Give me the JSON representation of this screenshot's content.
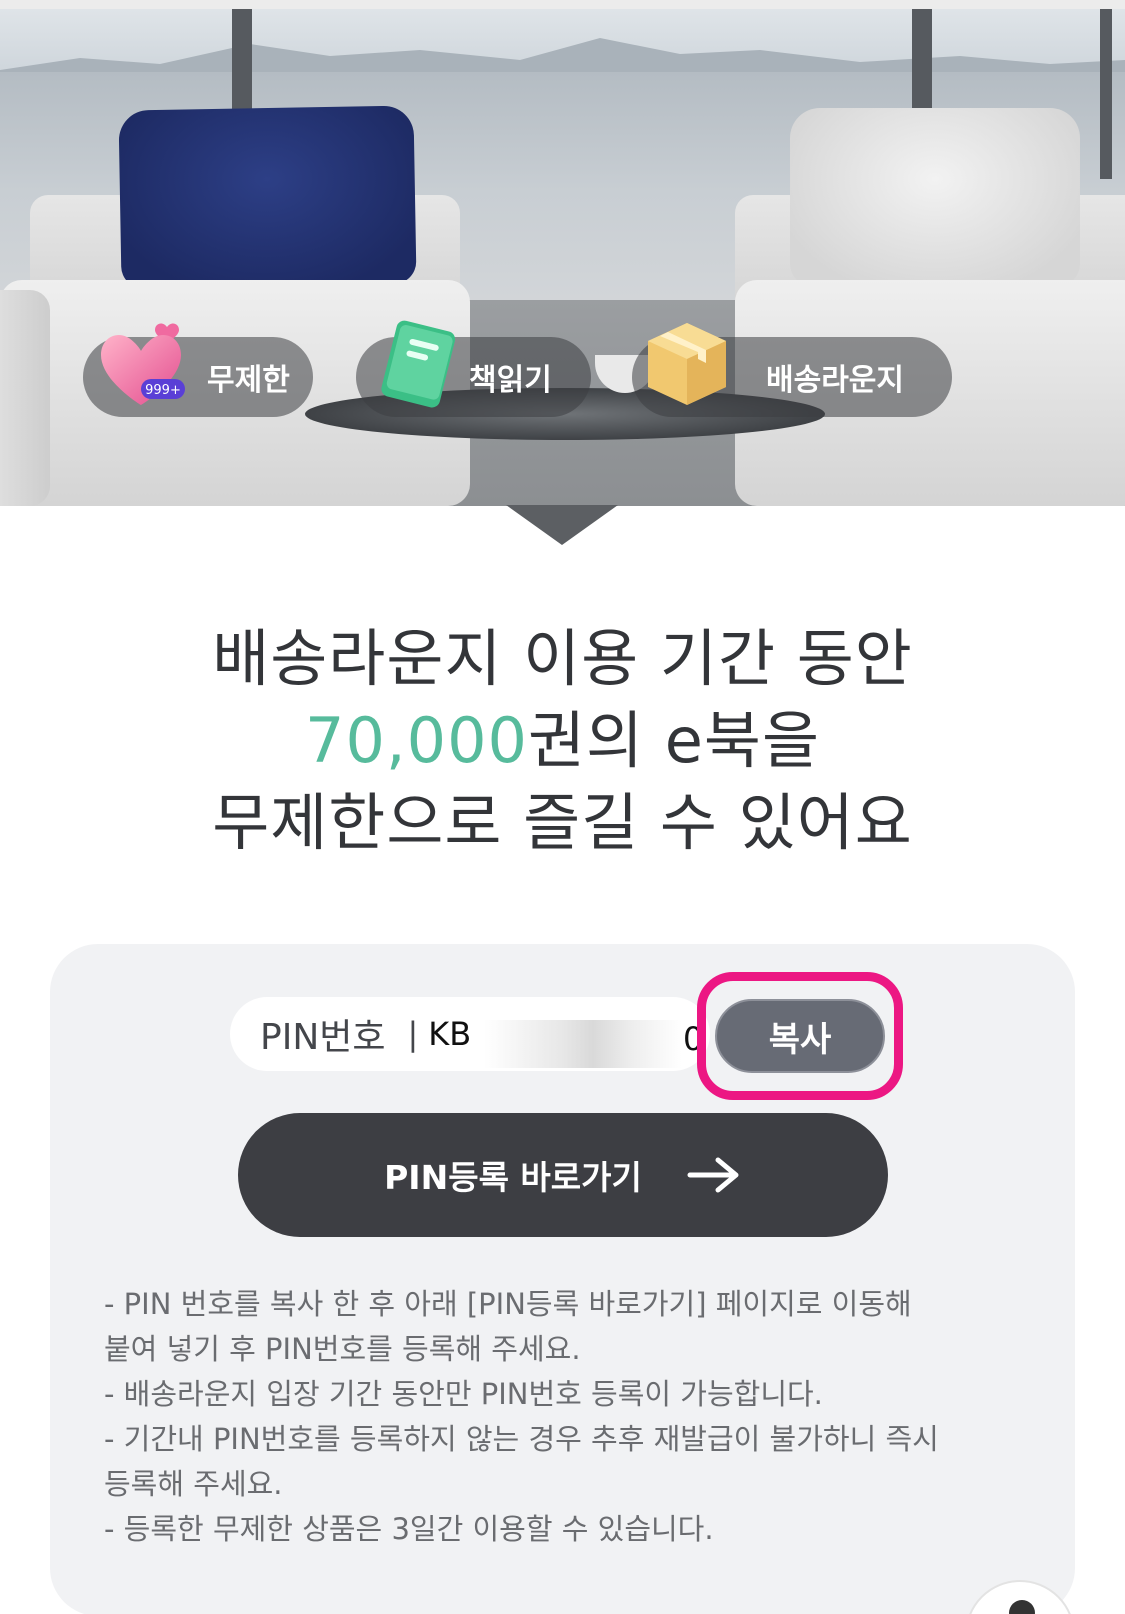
{
  "hero": {
    "chips": [
      {
        "label": "무제한",
        "icon": "heart-icon",
        "badge": "999+"
      },
      {
        "label": "책읽기",
        "icon": "book-icon"
      },
      {
        "label": "배송라운지",
        "icon": "box-icon"
      }
    ]
  },
  "headline": {
    "line1": "배송라운지 이용 기간 동안",
    "line2_accent": "70,000",
    "line2_rest": "권의 e북을",
    "line3": "무제한으로 즐길 수 있어요",
    "accent_color": "#57bb9c"
  },
  "pin": {
    "label": "PIN번호",
    "separator": "|",
    "value_prefix": "KB",
    "value_suffix": "0",
    "copy_label": "복사",
    "highlight_color": "#ec1783"
  },
  "register": {
    "label": "PIN등록 바로가기",
    "icon": "arrow-right-icon"
  },
  "notes": [
    "- PIN 번호를 복사 한 후 아래 [PIN등록 바로가기] 페이지로 이동해",
    "붙여 넣기 후 PIN번호를 등록해 주세요.",
    "- 배송라운지 입장 기간 동안만 PIN번호 등록이 가능합니다.",
    "- 기간내 PIN번호를 등록하지 않는 경우 추후 재발급이 불가하니 즉시",
    "등록해 주세요.",
    "- 등록한 무제한 상품은 3일간 이용할 수 있습니다."
  ]
}
